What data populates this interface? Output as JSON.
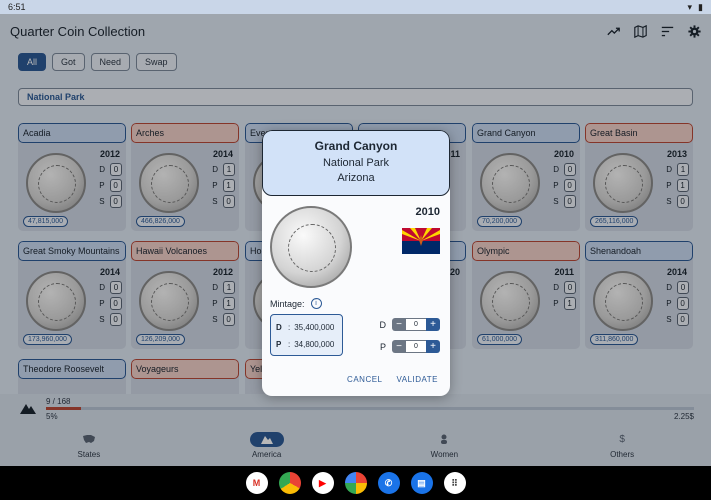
{
  "status_bar": {
    "time": "6:51"
  },
  "app_title": "Quarter Coin Collection",
  "filters": [
    "All",
    "Got",
    "Need",
    "Swap"
  ],
  "category": "National Park",
  "cards": [
    {
      "name": "Acadia",
      "year": "2012",
      "mintage": "47,815,000",
      "d": "0",
      "p": "0",
      "s": "0",
      "status": "got"
    },
    {
      "name": "Arches",
      "year": "2014",
      "mintage": "466,826,000",
      "d": "1",
      "p": "1",
      "s": "0",
      "status": "need"
    },
    {
      "name": "Ever...",
      "year": "",
      "mintage": "",
      "d": "",
      "p": "",
      "s": "",
      "status": "got"
    },
    {
      "name": "",
      "year": "2011",
      "mintage": "",
      "d": "",
      "p": "",
      "s": "",
      "status": "got"
    },
    {
      "name": "Grand Canyon",
      "year": "2010",
      "mintage": "70,200,000",
      "d": "0",
      "p": "0",
      "s": "0",
      "status": "got"
    },
    {
      "name": "Great Basin",
      "year": "2013",
      "mintage": "265,116,000",
      "d": "1",
      "p": "1",
      "s": "0",
      "status": "need"
    },
    {
      "name": "Great Smoky Mountains",
      "year": "2014",
      "mintage": "173,960,000",
      "d": "0",
      "p": "0",
      "s": "0",
      "status": "got"
    },
    {
      "name": "Hawaii Volcanoes",
      "year": "2012",
      "mintage": "126,209,000",
      "d": "1",
      "p": "1",
      "s": "0",
      "status": "need"
    },
    {
      "name": "Ho...",
      "year": "",
      "mintage": "",
      "d": "",
      "p": "",
      "s": "",
      "status": "got"
    },
    {
      "name": "",
      "year": "2020",
      "mintage": "",
      "d": "",
      "p": "",
      "s": "",
      "status": "got"
    },
    {
      "name": "Olympic",
      "year": "2011",
      "mintage": "61,000,000",
      "d": "0",
      "p": "1",
      "s": "",
      "status": "need"
    },
    {
      "name": "Shenandoah",
      "year": "2014",
      "mintage": "311,860,000",
      "d": "0",
      "p": "0",
      "s": "0",
      "status": "got"
    },
    {
      "name": "Theodore Roosevelt",
      "year": "",
      "mintage": "",
      "d": "",
      "p": "",
      "s": "",
      "status": "got"
    },
    {
      "name": "Voyageurs",
      "year": "",
      "mintage": "",
      "d": "",
      "p": "",
      "s": "",
      "status": "need"
    },
    {
      "name": "Yel...",
      "year": "",
      "mintage": "",
      "d": "",
      "p": "",
      "s": "",
      "status": "need"
    }
  ],
  "progress": {
    "count": "9 / 168",
    "percent": "5%",
    "fraction": 0.054,
    "value": "2.25$"
  },
  "nav": [
    {
      "label": "States",
      "icon": "us-map-icon"
    },
    {
      "label": "America",
      "icon": "mountain-icon"
    },
    {
      "label": "Women",
      "icon": "woman-icon"
    },
    {
      "label": "Others",
      "icon": "dollar-icon"
    }
  ],
  "dialog": {
    "title": "Grand Canyon",
    "subtitle_1": "National Park",
    "subtitle_2": "Arizona",
    "year": "2010",
    "mintage_label": "Mintage:",
    "mintage_d_key": "D",
    "mintage_d": "35,400,000",
    "mintage_p_key": "P",
    "mintage_p": "34,800,000",
    "stepper_d_label": "D",
    "stepper_d_value": "0",
    "stepper_p_label": "P",
    "stepper_p_value": "0",
    "cancel": "CANCEL",
    "validate": "VALIDATE"
  },
  "dock_apps": [
    "gmail-icon",
    "chrome-icon",
    "youtube-icon",
    "photos-icon",
    "phone-icon",
    "messages-icon",
    "apps-icon"
  ],
  "colors": {
    "accent": "#2d5a96",
    "need": "#b94a3a",
    "arizona_red": "#bf0a30",
    "arizona_blue": "#002868",
    "arizona_copper": "#ce5c17",
    "arizona_gold": "#fed700"
  }
}
